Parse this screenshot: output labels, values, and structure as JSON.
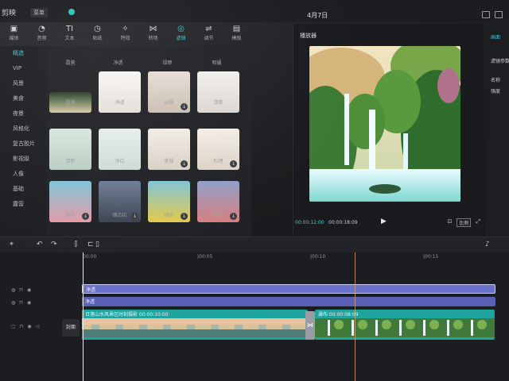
{
  "app": {
    "title": "剪映",
    "menu_label": "菜单",
    "project_date": "4月7日"
  },
  "tabs": [
    {
      "icon": "media-icon",
      "glyph": "▣",
      "label": "媒体"
    },
    {
      "icon": "audio-icon",
      "glyph": "◔",
      "label": "音频"
    },
    {
      "icon": "text-icon",
      "glyph": "TI",
      "label": "文本"
    },
    {
      "icon": "sticker-icon",
      "glyph": "◷",
      "label": "贴纸"
    },
    {
      "icon": "effects-icon",
      "glyph": "✧",
      "label": "特效"
    },
    {
      "icon": "transition-icon",
      "glyph": "⋈",
      "label": "转场"
    },
    {
      "icon": "filter-icon",
      "glyph": "◎",
      "label": "滤镜"
    },
    {
      "icon": "adjust-icon",
      "glyph": "⇌",
      "label": "调节"
    },
    {
      "icon": "template-icon",
      "glyph": "▤",
      "label": "模板"
    }
  ],
  "active_tab": 6,
  "leftnav": [
    "精选",
    "VIP",
    "风景",
    "美食",
    "夜景",
    "风格化",
    "复古胶片",
    "影视级",
    "人像",
    "基础",
    "露营"
  ],
  "active_nav": 0,
  "grid": {
    "top_row_labels": [
      "露营",
      "净透",
      "绿野",
      "明媚"
    ],
    "cards": [
      {
        "label": "露营",
        "download": false
      },
      {
        "label": "净透",
        "download": false
      },
      {
        "label": "淡雅",
        "download": true
      },
      {
        "label": "清新",
        "download": false
      },
      {
        "label": "清新",
        "download": false
      },
      {
        "label": "净白",
        "download": false
      },
      {
        "label": "美餐",
        "download": true
      },
      {
        "label": "料理",
        "download": true
      },
      {
        "label": "樱粉",
        "download": true
      },
      {
        "label": "德古拉",
        "download": true
      },
      {
        "label": "绿妍",
        "download": true
      },
      {
        "label": "暮色",
        "download": true
      }
    ]
  },
  "player": {
    "title": "播放器",
    "time_current": "00:00:12:00",
    "time_total": "00:00:18:09",
    "ratio_label": "比例"
  },
  "right_panel": {
    "top": "画面",
    "label_1": "滤镜参数",
    "label_2": "名称",
    "label_3": "强度"
  },
  "timeline": {
    "ruler_labels": [
      "00:00",
      "|00:05",
      "|00:10",
      "|00:15"
    ],
    "tracks": [
      {
        "label": "净透"
      },
      {
        "label": "净透"
      }
    ],
    "main_clip_label": "日落山水风景区时刻摄影  00:00:10:00",
    "second_clip_label": "瀑布  00:00:08:09",
    "cover_label": "封面"
  },
  "colors": {
    "accent": "#3fc9d8",
    "filter_track": "#6b72c9",
    "video_track": "#1fa49b"
  }
}
